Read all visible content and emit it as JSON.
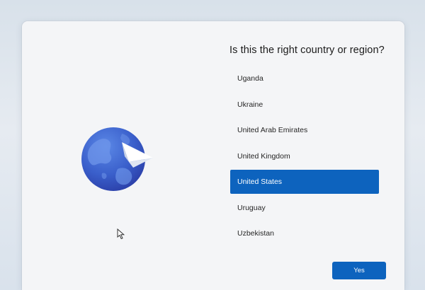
{
  "oobe": {
    "title": "Is this the right country or region?",
    "countries": [
      {
        "label": "Uganda",
        "selected": false
      },
      {
        "label": "Ukraine",
        "selected": false
      },
      {
        "label": "United Arab Emirates",
        "selected": false
      },
      {
        "label": "United Kingdom",
        "selected": false
      },
      {
        "label": "United States",
        "selected": true
      },
      {
        "label": "Uruguay",
        "selected": false
      },
      {
        "label": "Uzbekistan",
        "selected": false
      }
    ],
    "yes_label": "Yes"
  },
  "icons": {
    "illustration": "globe-with-paper-plane-icon",
    "pointer": "mouse-pointer-icon"
  },
  "colors": {
    "accent": "#0d63be",
    "globe_dark": "#2f4fb8",
    "globe_light": "#5a86e3",
    "background": "#f4f5f7"
  }
}
